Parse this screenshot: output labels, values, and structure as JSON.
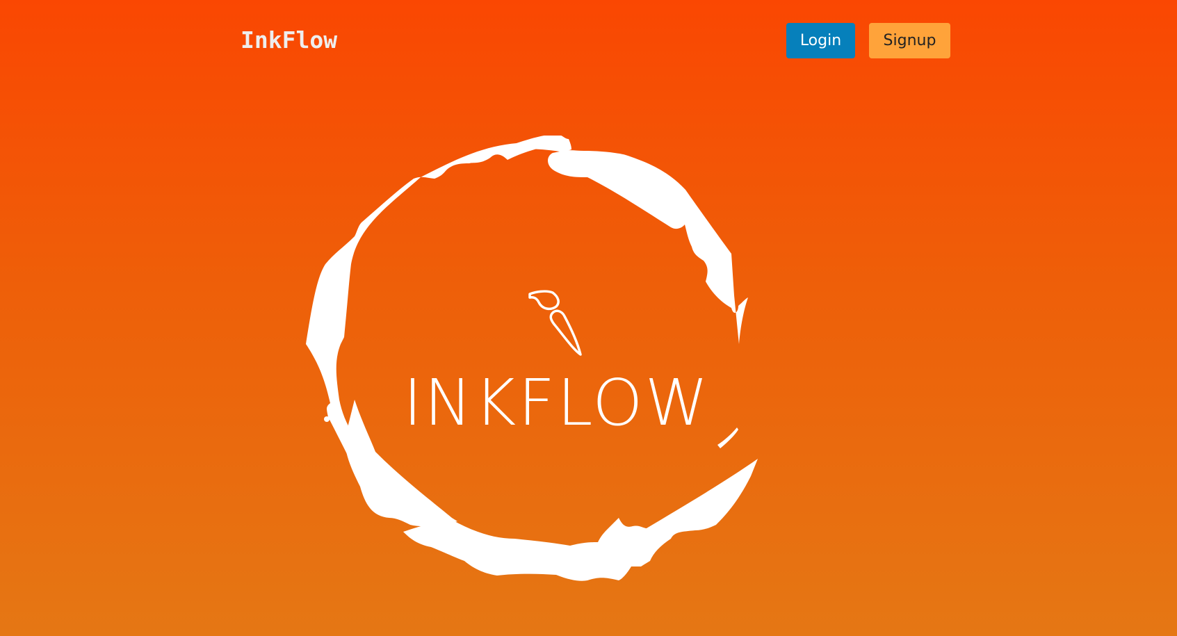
{
  "header": {
    "brand": "InkFlow",
    "login_label": "Login",
    "signup_label": "Signup"
  },
  "hero": {
    "logo_text": "INKFLOW",
    "icon": "paintbrush-icon"
  },
  "colors": {
    "background_top": "#fa4702",
    "background_bottom": "#e57714",
    "login_button": "#0680bb",
    "signup_button": "#ffa33a",
    "brand_text": "#eeeeee",
    "logo": "#ffffff"
  }
}
